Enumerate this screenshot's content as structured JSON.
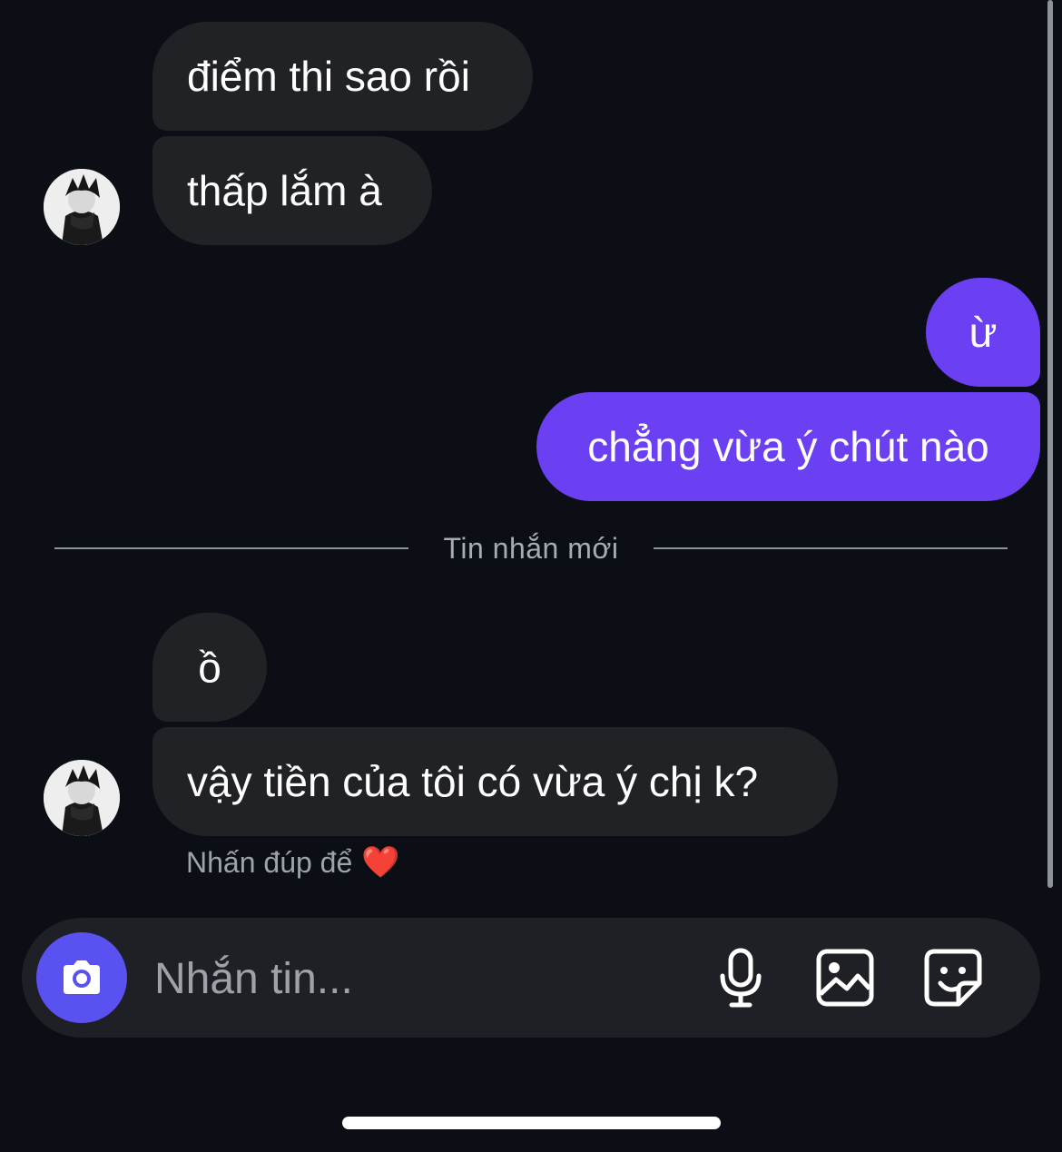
{
  "messages": [
    {
      "text": "điểm thi sao rồi",
      "sender": "them"
    },
    {
      "text": "thấp lắm à",
      "sender": "them"
    },
    {
      "text": "ừ",
      "sender": "me"
    },
    {
      "text": "chẳng vừa ý chút nào",
      "sender": "me"
    },
    {
      "text": "ồ",
      "sender": "them"
    },
    {
      "text": "vậy tiền của tôi có vừa ý chị k?",
      "sender": "them"
    }
  ],
  "divider": {
    "label": "Tin nhắn mới"
  },
  "hint": {
    "text": "Nhấn đúp để",
    "emoji": "❤️"
  },
  "composer": {
    "placeholder": "Nhắn tin...",
    "icons": [
      "camera-icon",
      "microphone-icon",
      "image-icon",
      "sticker-icon"
    ]
  },
  "colors": {
    "background": "#0b0e14",
    "incoming_bubble": "#202226",
    "outgoing_bubble": "#6b3ff2",
    "camera_button": "#5a52f0"
  }
}
